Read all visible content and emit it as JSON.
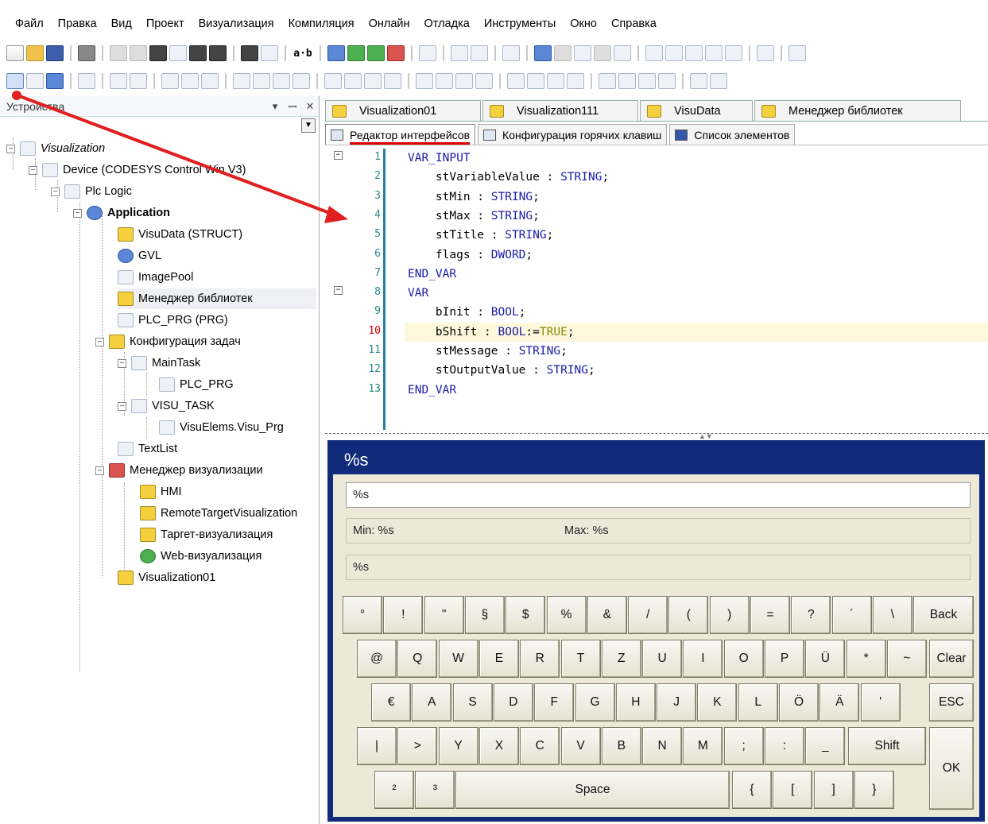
{
  "menu": [
    "Файл",
    "Правка",
    "Вид",
    "Проект",
    "Визуализация",
    "Компиляция",
    "Онлайн",
    "Отладка",
    "Инструменты",
    "Окно",
    "Справка"
  ],
  "toolbar": {
    "text_tool": "a·b"
  },
  "devices_panel": {
    "title": "Устройства",
    "pin": "ꟷ",
    "close": "✕",
    "tree": {
      "root": "Visualization",
      "device": "Device (CODESYS Control Win V3)",
      "plc_logic": "Plc Logic",
      "application": "Application",
      "visudata": "VisuData (STRUCT)",
      "gvl": "GVL",
      "imagepool": "ImagePool",
      "libmanager": "Менеджер библиотек",
      "plc_prg": "PLC_PRG (PRG)",
      "taskconfig": "Конфигурация задач",
      "maintask": "MainTask",
      "maintask_call": "PLC_PRG",
      "visutask": "VISU_TASK",
      "visutask_call": "VisuElems.Visu_Prg",
      "textlist": "TextList",
      "visumanager": "Менеджер визуализации",
      "hmi": "HMI",
      "remote": "RemoteTargetVisualization",
      "target": "Таргет-визуализация",
      "web": "Web-визуализация",
      "vis01": "Visualization01"
    }
  },
  "doc_tabs": [
    "Visualization01",
    "Visualization111",
    "VisuData",
    "Менеджер библиотек"
  ],
  "sub_tabs": [
    "Редактор интерфейсов",
    "Конфигурация горячих клавиш",
    "Список элементов"
  ],
  "code": {
    "lines": [
      {
        "n": "1",
        "parts": [
          [
            "kw",
            "VAR_INPUT"
          ]
        ]
      },
      {
        "n": "2",
        "parts": [
          [
            "",
            "    stVariableValue : "
          ],
          [
            "tp",
            "STRING"
          ],
          [
            "",
            ";"
          ]
        ]
      },
      {
        "n": "3",
        "parts": [
          [
            "",
            "    stMin : "
          ],
          [
            "tp",
            "STRING"
          ],
          [
            "",
            ";"
          ]
        ]
      },
      {
        "n": "4",
        "parts": [
          [
            "",
            "    stMax : "
          ],
          [
            "tp",
            "STRING"
          ],
          [
            "",
            ";"
          ]
        ]
      },
      {
        "n": "5",
        "parts": [
          [
            "",
            "    stTitle : "
          ],
          [
            "tp",
            "STRING"
          ],
          [
            "",
            ";"
          ]
        ]
      },
      {
        "n": "6",
        "parts": [
          [
            "",
            "    flags : "
          ],
          [
            "tp",
            "DWORD"
          ],
          [
            "",
            ";"
          ]
        ]
      },
      {
        "n": "7",
        "parts": [
          [
            "kw",
            "END_VAR"
          ]
        ]
      },
      {
        "n": "8",
        "parts": [
          [
            "kw",
            "VAR"
          ]
        ]
      },
      {
        "n": "9",
        "parts": [
          [
            "",
            "    bInit : "
          ],
          [
            "tp",
            "BOOL"
          ],
          [
            "",
            ";"
          ]
        ]
      },
      {
        "n": "10",
        "parts": [
          [
            "",
            "    bShift : "
          ],
          [
            "tp",
            "BOOL"
          ],
          [
            "",
            ":="
          ],
          [
            "tr",
            "TRUE"
          ],
          [
            "",
            ";"
          ]
        ]
      },
      {
        "n": "11",
        "parts": [
          [
            "",
            "    stMessage : "
          ],
          [
            "tp",
            "STRING"
          ],
          [
            "",
            ";"
          ]
        ]
      },
      {
        "n": "12",
        "parts": [
          [
            "",
            "    stOutputValue : "
          ],
          [
            "tp",
            "STRING"
          ],
          [
            "",
            ";"
          ]
        ]
      },
      {
        "n": "13",
        "parts": [
          [
            "kw",
            "END_VAR"
          ]
        ]
      }
    ],
    "current_line": "10"
  },
  "visu": {
    "title": "%s",
    "input_value": "%s",
    "min_label": "Min: %s",
    "max_label": "Max: %s",
    "message": "%s",
    "row1": [
      "°",
      "!",
      "\"",
      "§",
      "$",
      "%",
      "&",
      "/",
      "(",
      ")",
      "=",
      "?",
      "´",
      "\\"
    ],
    "row2": [
      "@",
      "Q",
      "W",
      "E",
      "R",
      "T",
      "Z",
      "U",
      "I",
      "O",
      "P",
      "Ü",
      "*",
      "~"
    ],
    "row3": [
      "€",
      "A",
      "S",
      "D",
      "F",
      "G",
      "H",
      "J",
      "K",
      "L",
      "Ö",
      "Ä",
      "'"
    ],
    "row4": [
      "|",
      ">",
      "Y",
      "X",
      "C",
      "V",
      "B",
      "N",
      "M",
      ";",
      ":",
      "_"
    ],
    "row5": [
      "²",
      "³"
    ],
    "row5b": [
      "{",
      "[",
      "]",
      "}"
    ],
    "back": "Back",
    "clear": "Clear",
    "esc": "ESC",
    "shift": "Shift",
    "ok": "OK",
    "space": "Space"
  },
  "colors": {
    "visu_frame": "#0f2b7a",
    "visu_bg": "#ece9d8",
    "annotation": "#e02020"
  }
}
